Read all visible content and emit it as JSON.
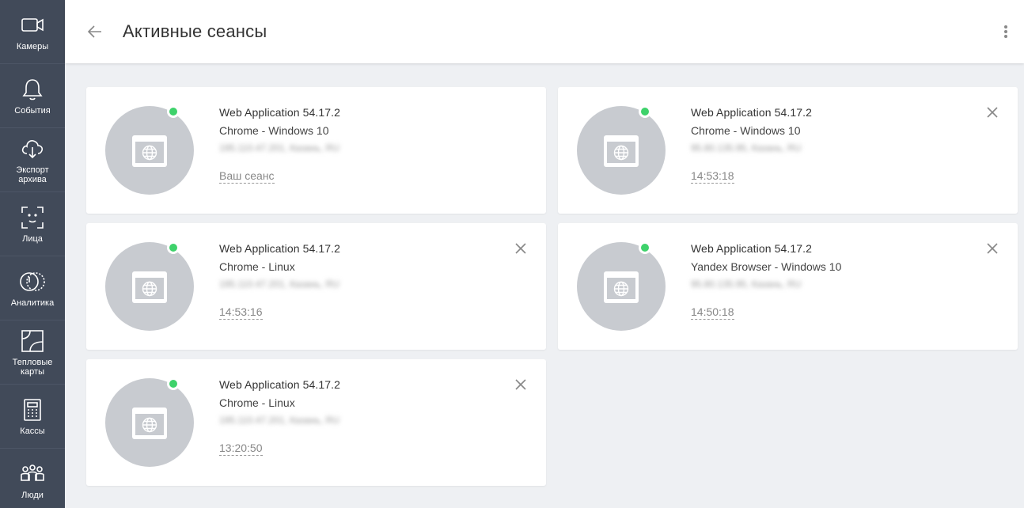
{
  "sidebar": {
    "items": [
      {
        "label": "Камеры",
        "icon": "video-camera-icon"
      },
      {
        "label": "События",
        "icon": "bell-icon"
      },
      {
        "label": "Экспорт архива",
        "icon": "cloud-download-icon"
      },
      {
        "label": "Лица",
        "icon": "face-scan-icon"
      },
      {
        "label": "Аналитика",
        "icon": "analytics-icon"
      },
      {
        "label": "Тепловые карты",
        "icon": "heatmap-icon"
      },
      {
        "label": "Кассы",
        "icon": "cash-register-icon"
      },
      {
        "label": "Люди",
        "icon": "people-icon"
      }
    ]
  },
  "header": {
    "title": "Активные сеансы",
    "back_icon": "arrow-left-icon",
    "menu_icon": "more-vertical-icon"
  },
  "colors": {
    "sidebar": "#414a59",
    "online": "#3ed26b",
    "avatar": "#c8cbd0",
    "background": "#eef0f3"
  },
  "sessions": [
    {
      "app": "Web Application 54.17.2",
      "client": "Chrome - Windows 10",
      "ip": "195.110.47.201, Казань, RU",
      "time": "Ваш сеанс"
    },
    {
      "app": "Web Application 54.17.2",
      "client": "Chrome - Windows 10",
      "ip": "95.80.135.95, Казань, RU",
      "time": "14:53:18"
    },
    {
      "app": "Web Application 54.17.2",
      "client": "Chrome - Linux",
      "ip": "195.110.47.201, Казань, RU",
      "time": "14:53:16"
    },
    {
      "app": "Web Application 54.17.2",
      "client": "Yandex Browser - Windows 10",
      "ip": "95.80.135.95, Казань, RU",
      "time": "14:50:18"
    },
    {
      "app": "Web Application 54.17.2",
      "client": "Chrome - Linux",
      "ip": "195.110.47.201, Казань, RU",
      "time": "13:20:50"
    }
  ]
}
